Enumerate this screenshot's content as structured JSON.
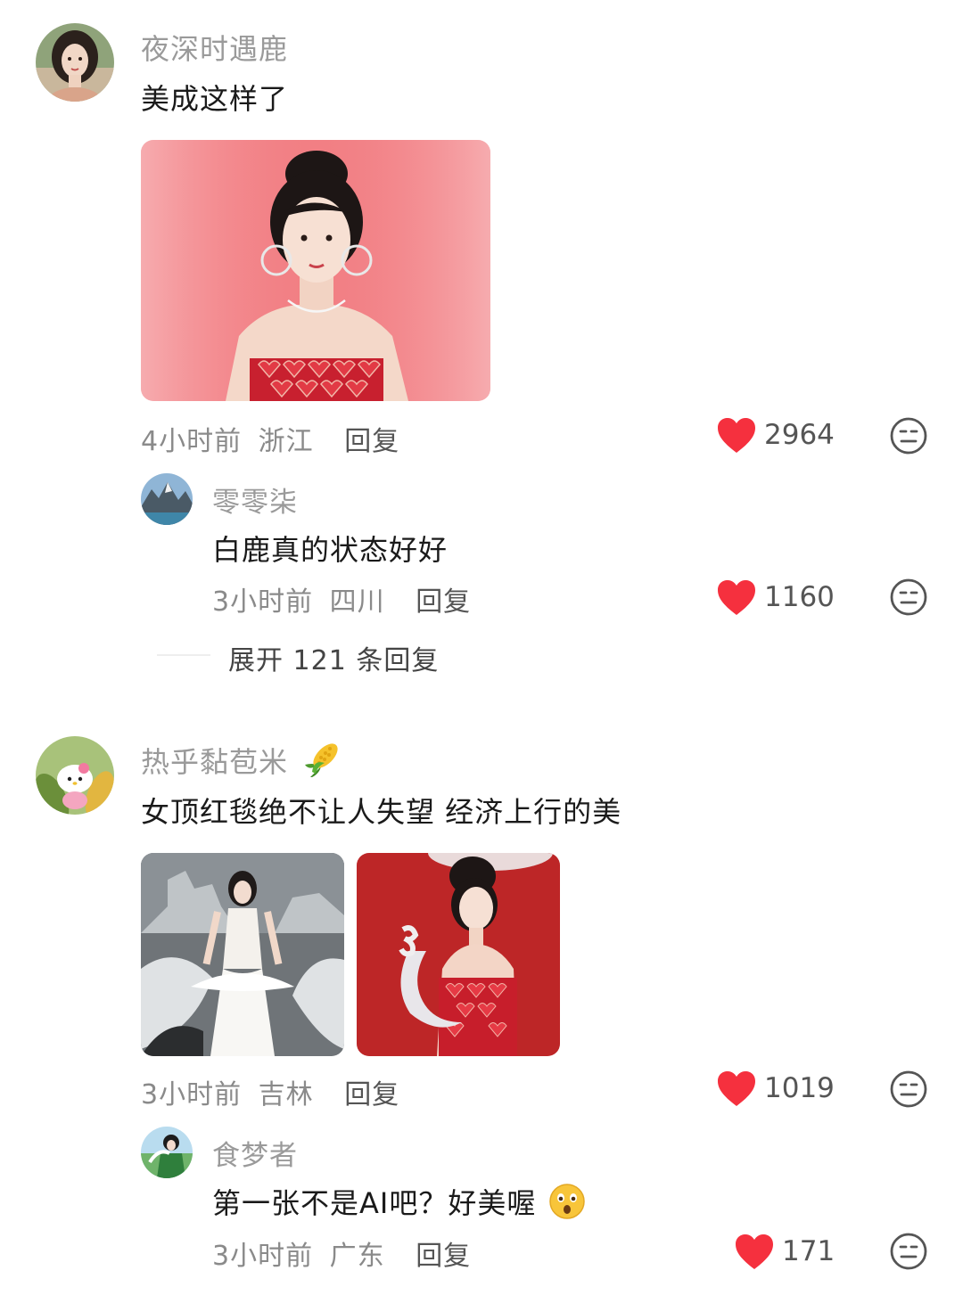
{
  "colors": {
    "like": "#F5303E",
    "meta": "#8A8A8A",
    "username": "#9A9A9A"
  },
  "comments": [
    {
      "username": "夜深时遇鹿",
      "content": "美成这样了",
      "time": "4小时前",
      "location": "浙江",
      "reply_label": "回复",
      "likes": "2964",
      "images": [
        "red-carpet-photo"
      ],
      "replies": [
        {
          "username": "零零柒",
          "content": "白鹿真的状态好好",
          "time": "3小时前",
          "location": "四川",
          "reply_label": "回复",
          "likes": "1160"
        }
      ],
      "expand_label": "展开 121 条回复"
    },
    {
      "username": "热乎黏苞米",
      "username_emoji": "corn-emoji",
      "content": "女顶红毯绝不让人失望 经济上行的美",
      "time": "3小时前",
      "location": "吉林",
      "reply_label": "回复",
      "likes": "1019",
      "images": [
        "white-gown-photo",
        "red-dress-award-photo"
      ],
      "replies": [
        {
          "username": "食梦者",
          "content": "第一张不是AI吧？好美喔",
          "content_emoji": "astonished-face-emoji",
          "time": "3小时前",
          "location": "广东",
          "reply_label": "回复",
          "likes": "171"
        }
      ]
    }
  ]
}
